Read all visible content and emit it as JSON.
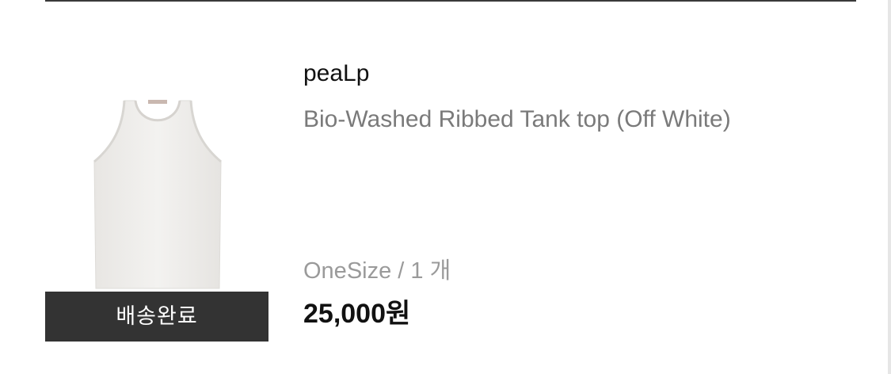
{
  "order_item": {
    "brand": "peaLp",
    "product_name": "Bio-Washed Ribbed Tank top (Off White)",
    "option": "OneSize / 1 개",
    "price": "25,000원",
    "status": "배송완료",
    "image_icon": "tank-top-image"
  },
  "colors": {
    "status_bg": "#333333",
    "product_text": "#7a7a7a",
    "option_text": "#9a9a9a",
    "tank_fill": "#f1f0ee"
  }
}
